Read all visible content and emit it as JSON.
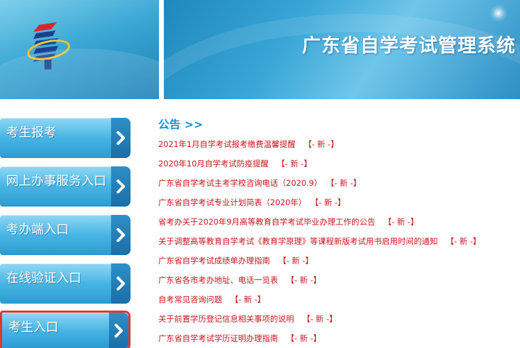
{
  "header": {
    "site_title": "广东省自学考试管理系统"
  },
  "sidebar": {
    "items": [
      {
        "label": "考生报考",
        "active": false
      },
      {
        "label": "网上办事服务入口",
        "active": false
      },
      {
        "label": "考办端入口",
        "active": false
      },
      {
        "label": "在线验证入口",
        "active": false
      },
      {
        "label": "考生入口",
        "active": true
      }
    ]
  },
  "announcements": {
    "title": "公告 >>",
    "new_tag": "【- 新 -】",
    "items": [
      {
        "text": "2021年1月自学考试报考缴费温馨提醒"
      },
      {
        "text": "2020年10月自学考试防疫提醒"
      },
      {
        "text": "广东省自学考试主考学校咨询电话（2020.9）"
      },
      {
        "text": "广东省自学考试专业计划简表（2020年）"
      },
      {
        "text": "省考办关于2020年9月高等教育自学考试毕业办理工作的公告"
      },
      {
        "text": "关于调整高等教育自学考试《教育学原理》等课程新版考试用书启用时间的通知"
      },
      {
        "text": "广东省自学考试成绩单办理指南"
      },
      {
        "text": "广东省各市考办地址、电话一览表"
      },
      {
        "text": "自考常见咨询问题"
      },
      {
        "text": "关于前置学历登记信息相关事项的说明"
      },
      {
        "text": "广东省自学考试学历证明办理指南"
      }
    ]
  },
  "colors": {
    "accent": "#1a8ccc",
    "notice_red": "#c8161d",
    "active_border": "#e2362c"
  }
}
